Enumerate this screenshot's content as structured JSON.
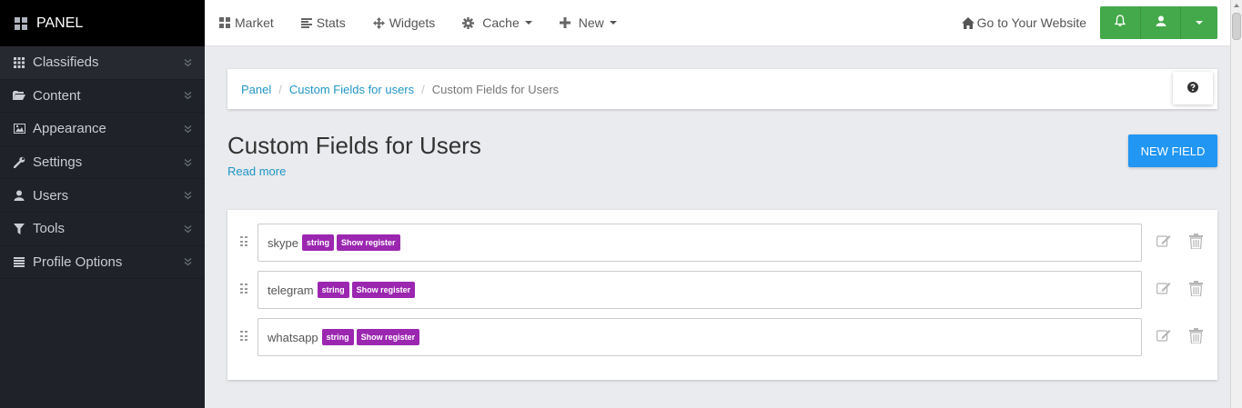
{
  "sidebar": {
    "brand": "PANEL",
    "items": [
      {
        "label": "Classifieds",
        "icon": "th-icon"
      },
      {
        "label": "Content",
        "icon": "folder-open-icon"
      },
      {
        "label": "Appearance",
        "icon": "picture-icon"
      },
      {
        "label": "Settings",
        "icon": "wrench-icon"
      },
      {
        "label": "Users",
        "icon": "user-icon"
      },
      {
        "label": "Tools",
        "icon": "filter-icon"
      },
      {
        "label": "Profile Options",
        "icon": "list-icon"
      }
    ]
  },
  "topbar": {
    "market": "Market",
    "stats": "Stats",
    "widgets": "Widgets",
    "cache": "Cache",
    "new": "New",
    "website": "Go to Your Website"
  },
  "breadcrumb": {
    "home": "Panel",
    "section": "Custom Fields for users",
    "current": "Custom Fields for Users"
  },
  "page": {
    "title": "Custom Fields for Users",
    "read_more": "Read more",
    "new_field": "NEW FIELD"
  },
  "fields": [
    {
      "name": "skype",
      "type": "string",
      "flag": "Show register"
    },
    {
      "name": "telegram",
      "type": "string",
      "flag": "Show register"
    },
    {
      "name": "whatsapp",
      "type": "string",
      "flag": "Show register"
    }
  ],
  "colors": {
    "sidebar": "#1f2229",
    "accent_green": "#43a94a",
    "accent_blue": "#2196f3",
    "badge_purple": "#9b27b0",
    "link": "#2196c4"
  }
}
